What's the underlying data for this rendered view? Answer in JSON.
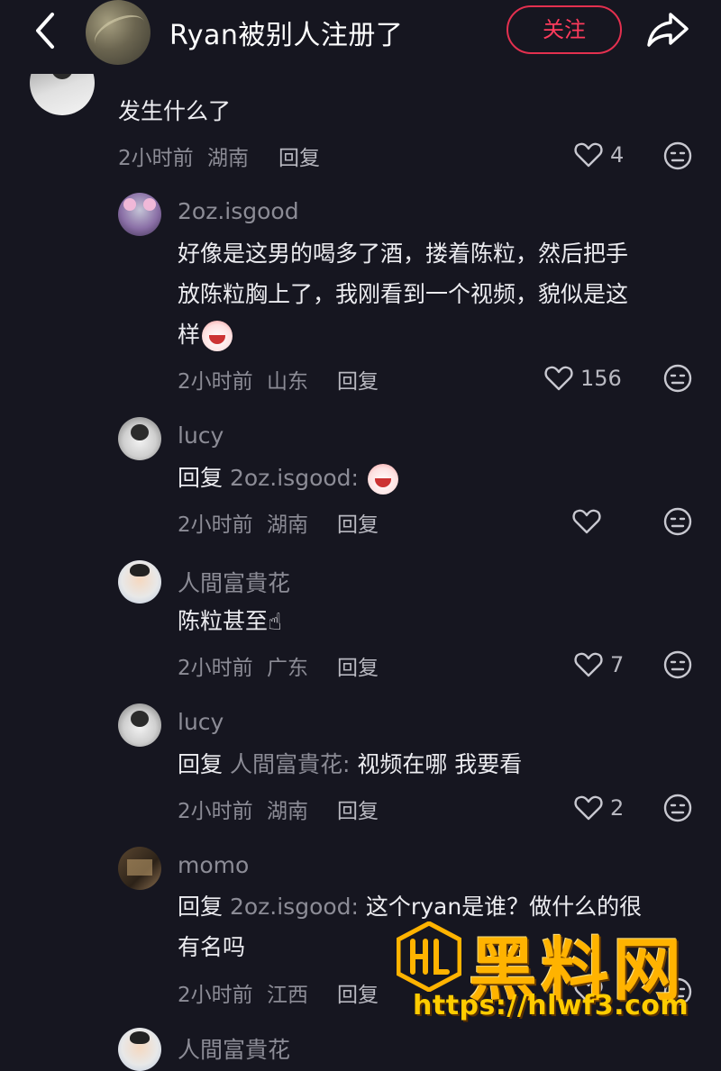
{
  "header": {
    "title": "Ryan被别人注册了",
    "follow_label": "关注"
  },
  "comments": [
    {
      "text": "发生什么了",
      "time": "2小时前",
      "location": "湖南",
      "reply_label": "回复",
      "likes": "4"
    },
    {
      "username": "2oz.isgood",
      "text_line1": "好像是这男的喝多了酒，搂着陈粒，然后把手",
      "text_line2": "放陈粒胸上了，我刚看到一个视频，貌似是这",
      "text_line3": "样",
      "time": "2小时前",
      "location": "山东",
      "reply_label": "回复",
      "likes": "156"
    },
    {
      "username": "lucy",
      "reply_prefix": "回复",
      "reply_target": "2oz.isgood:",
      "text": "",
      "time": "2小时前",
      "location": "湖南",
      "reply_label": "回复",
      "likes": ""
    },
    {
      "username": "人間富貴花",
      "text": "陈粒甚至",
      "time": "2小时前",
      "location": "广东",
      "reply_label": "回复",
      "likes": "7"
    },
    {
      "username": "lucy",
      "reply_prefix": "回复",
      "reply_target": "人間富貴花:",
      "text": "视频在哪 我要看",
      "time": "2小时前",
      "location": "湖南",
      "reply_label": "回复",
      "likes": "2"
    },
    {
      "username": "momo",
      "reply_prefix": "回复",
      "reply_target": "2oz.isgood:",
      "text_line1": "这个ryan是谁？做什么的很",
      "text_line2": "有名吗",
      "time": "2小时前",
      "location": "江西",
      "reply_label": "回复",
      "likes": ""
    },
    {
      "username": "人間富貴花"
    }
  ],
  "watermark": {
    "brand": "黑料网",
    "url": "https://hlwf3.com"
  },
  "colors": {
    "background": "#161620",
    "accent": "#e3304f",
    "watermark": "#ffb300"
  }
}
